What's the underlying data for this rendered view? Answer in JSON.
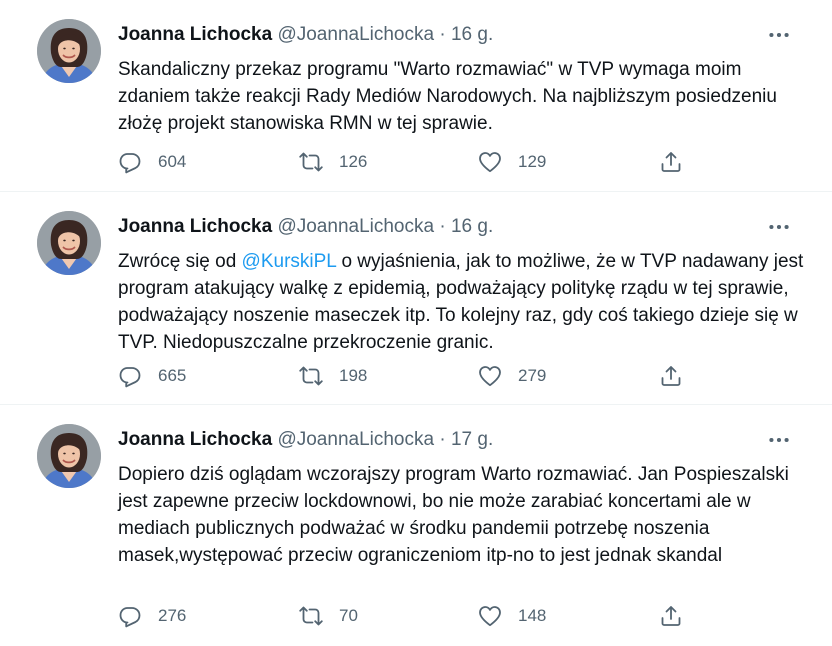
{
  "colors": {
    "text": "#0f1419",
    "secondary": "#536471",
    "link": "#1d9bf0",
    "divider": "#eff3f4"
  },
  "tweets": [
    {
      "name": "Joanna Lichocka",
      "handle": "@JoannaLichocka",
      "separator": "·",
      "time": "16 g.",
      "text_parts": [
        "Skandaliczny przekaz programu \"Warto rozmawiać\" w TVP wymaga moim zdaniem także reakcji Rady Mediów Narodowych. Na najbliższym posiedzeniu złożę projekt stanowiska RMN w tej sprawie."
      ],
      "replies": "604",
      "retweets": "126",
      "likes": "129"
    },
    {
      "name": "Joanna Lichocka",
      "handle": "@JoannaLichocka",
      "separator": "·",
      "time": "16 g.",
      "text_before": "Zwrócę się od ",
      "mention": "@KurskiPL",
      "text_after": " o wyjaśnienia, jak to możliwe, że w TVP nadawany jest program atakujący walkę z epidemią, podważający politykę rządu w tej sprawie, podważający noszenie maseczek itp. To kolejny raz, gdy coś takiego dzieje się w TVP. Niedopuszczalne przekroczenie granic.",
      "replies": "665",
      "retweets": "198",
      "likes": "279"
    },
    {
      "name": "Joanna Lichocka",
      "handle": "@JoannaLichocka",
      "separator": "·",
      "time": "17 g.",
      "text": "Dopiero dziś oglądam wczorajszy program Warto rozmawiać. Jan Pospieszalski jest zapewne przeciw lockdownowi, bo nie może zarabiać koncertami ale w mediach publicznych podważać w środku pandemii potrzebę noszenia masek,występować przeciw ograniczeniom itp-no to jest jednak skandal",
      "replies": "276",
      "retweets": "70",
      "likes": "148"
    }
  ],
  "icons": {
    "more": "more-icon",
    "reply": "reply-icon",
    "retweet": "retweet-icon",
    "like": "heart-icon",
    "share": "share-icon"
  }
}
